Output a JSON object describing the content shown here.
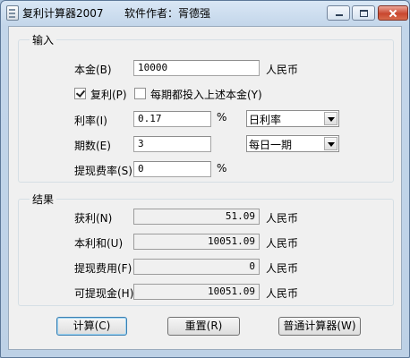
{
  "window": {
    "title": "复利计算器2007",
    "author": "软件作者：胥德强"
  },
  "input": {
    "group_title": "输入",
    "principal_label": "本金(B)",
    "principal_value": "10000",
    "principal_unit": "人民币",
    "compound_label": "复利(P)",
    "compound_checked": true,
    "invest_label": "每期都投入上述本金(Y)",
    "invest_checked": false,
    "rate_label": "利率(I)",
    "rate_value": "0.17",
    "rate_unit": "%",
    "rate_type": "日利率",
    "periods_label": "期数(E)",
    "periods_value": "3",
    "period_type": "每日一期",
    "fee_label": "提现费率(S)",
    "fee_value": "0",
    "fee_unit": "%"
  },
  "result": {
    "group_title": "结果",
    "profit_label": "获利(N)",
    "profit_value": "51.09",
    "profit_unit": "人民币",
    "total_label": "本利和(U)",
    "total_value": "10051.09",
    "total_unit": "人民币",
    "fee_label": "提现费用(F)",
    "fee_value": "0",
    "fee_unit": "人民币",
    "withdraw_label": "可提现金(H)",
    "withdraw_value": "10051.09",
    "withdraw_unit": "人民币"
  },
  "buttons": {
    "calc": "计算(C)",
    "reset": "重置(R)",
    "normal": "普通计算器(W)"
  },
  "colors": {
    "titlebar": "#c3d6ea",
    "close_button": "#c9472f",
    "client_bg": "#f0f0f0"
  }
}
